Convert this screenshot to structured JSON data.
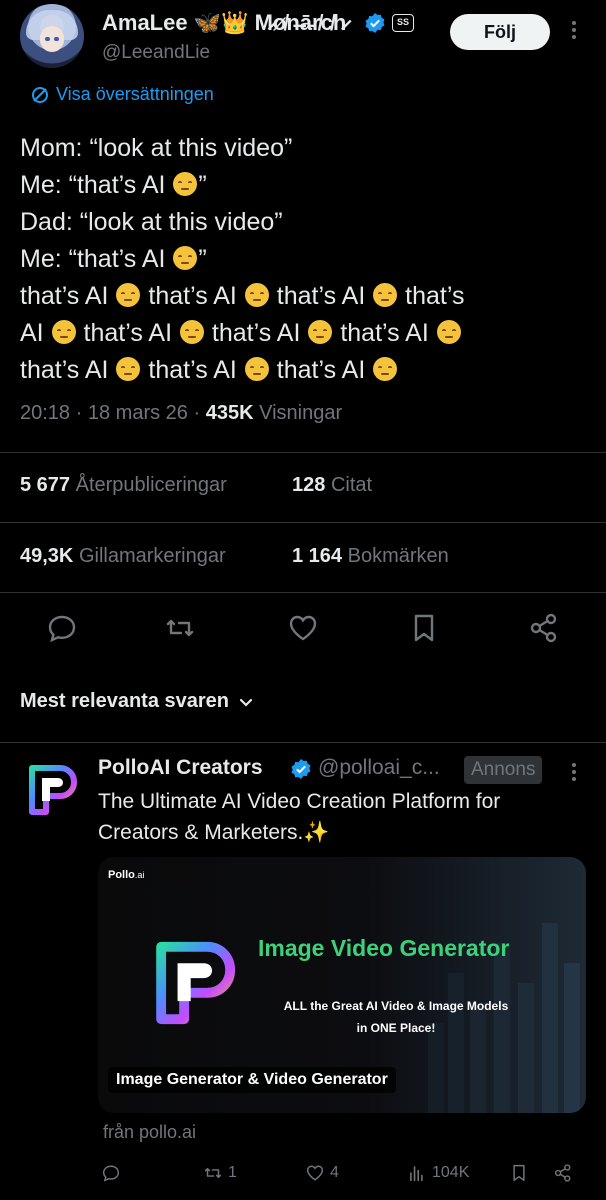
{
  "post": {
    "author": {
      "display_name": "AmaLee 🦋👑 M̷ø̸n̶ā̵r̸c̸h̷",
      "handle": "@LeeandLie",
      "verified": true,
      "extra_badge": "SS"
    },
    "follow_label": "Följ",
    "translate_label": "Visa översättningen",
    "text_lines": [
      "Mom: “look at this video”",
      "Me: “that’s AI ",
      "Dad: “look at this video”",
      "Me: “that’s AI ",
      "that’s AI ",
      "that’s AI ",
      "that’s AI ",
      "that’s",
      "AI ",
      "that’s AI ",
      "that’s AI ",
      "that’s AI ",
      "that’s AI ",
      "that’s AI ",
      "that’s AI "
    ],
    "closing_quote": "”",
    "time": "20:18",
    "date": "18 mars 26",
    "separator": "·",
    "views_count": "435K",
    "views_label": "Visningar",
    "stats": {
      "reposts_count": "5 677",
      "reposts_label": "Återpubliceringar",
      "quotes_count": "128",
      "quotes_label": "Citat",
      "likes_count": "49,3K",
      "likes_label": "Gillamarkeringar",
      "bookmarks_count": "1 164",
      "bookmarks_label": "Bokmärken"
    },
    "actions": [
      "reply-icon",
      "repost-icon",
      "like-icon",
      "bookmark-icon",
      "share-icon"
    ]
  },
  "replies": {
    "sort_label": "Mest relevanta svaren"
  },
  "ad": {
    "name": "PolloAI Creators",
    "handle": "@polloai_c...",
    "badge": "Annons",
    "verified": true,
    "text": "The Ultimate AI Video Creation Platform for Creators & Marketers.✨",
    "card": {
      "brand": "Pollo",
      "brand_suffix": ".ai",
      "headline": "Image Video Generator",
      "subtext_line1": "ALL the Great AI Video & Image Models",
      "subtext_line2": "in ONE Place!",
      "caption": "Image Generator & Video Generator"
    },
    "source": "från pollo.ai",
    "actions": {
      "reply_count": "",
      "repost_count": "1",
      "like_count": "4",
      "views_count": "104K"
    }
  },
  "colors": {
    "background": "#000000",
    "text": "#e7e9ea",
    "muted": "#71767b",
    "accent": "#1d9bf0",
    "divider": "#2f3336",
    "headline_green": "#3dd27a"
  }
}
